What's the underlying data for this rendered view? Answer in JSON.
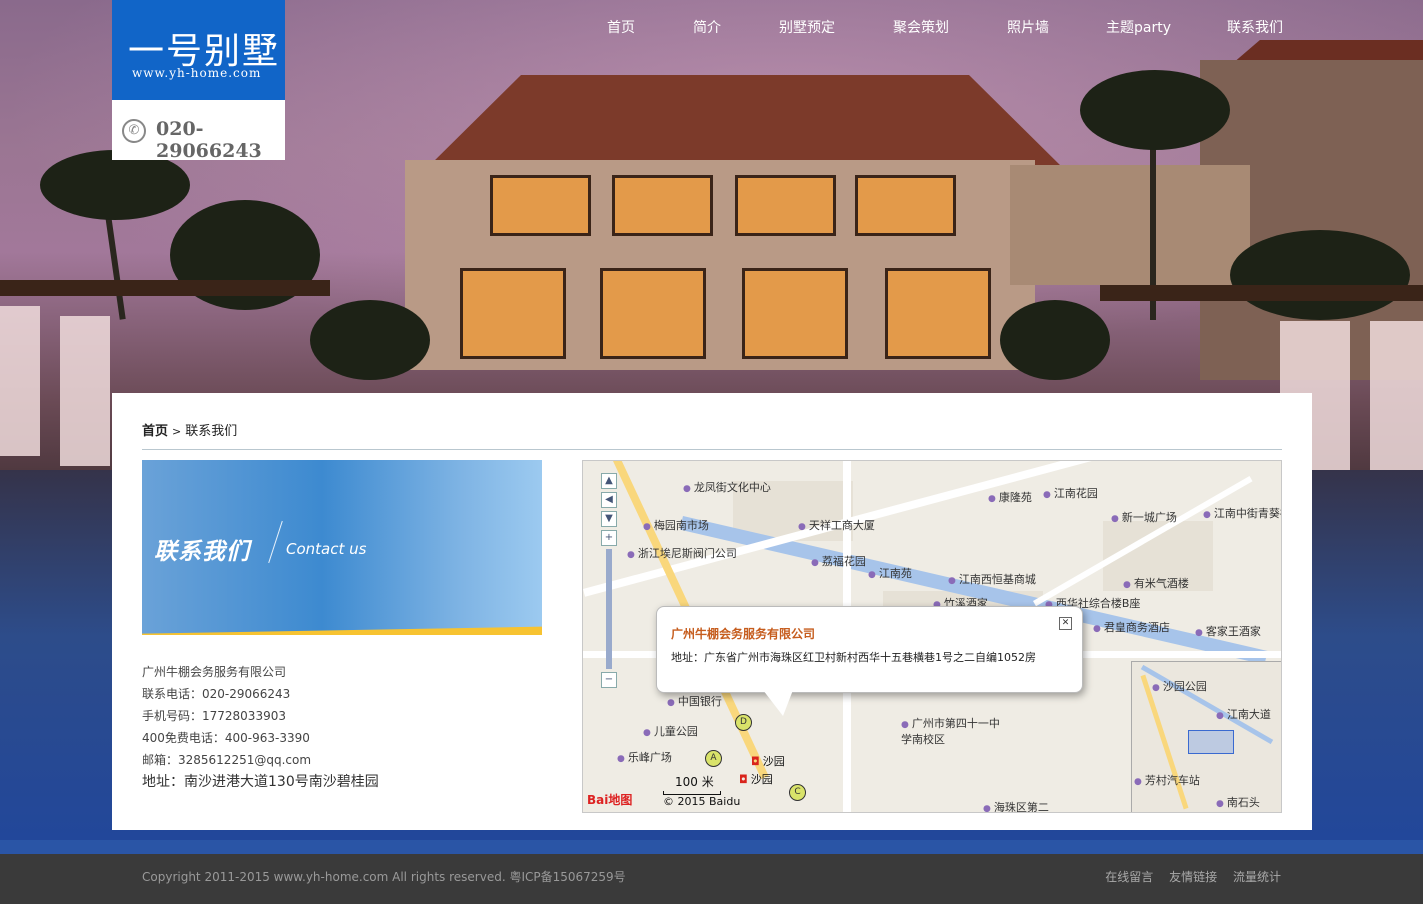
{
  "site": {
    "logo_title": "一号别墅",
    "logo_url": "www.yh-home.com",
    "phone": "020-29066243"
  },
  "nav": [
    "首页",
    "简介",
    "别墅预定",
    "聚会策划",
    "照片墙",
    "主题party",
    "联系我们"
  ],
  "breadcrumb": {
    "home": "首页",
    "sep": ">",
    "current": "联系我们"
  },
  "banner": {
    "title_cn": "联系我们",
    "title_en": "Contact us"
  },
  "contact": {
    "company": "广州牛棚会务服务有限公司",
    "tel": "联系电话：020-29066243",
    "mobile": "手机号码：17728033903",
    "free": "400免费电话：400-963-3390",
    "email": "邮箱：3285612251@qq.com",
    "address": "地址：南沙进港大道130号南沙碧桂园"
  },
  "map": {
    "info_title": "广州牛棚会务服务有限公司",
    "info_address": "地址：广东省广州市海珠区红卫村新村西华十五巷横巷1号之二自编1052房",
    "scale": "100 米",
    "copyright": "© 2015 Baidu",
    "logo": "Bai地图",
    "pois": [
      "龙凤街文化中心",
      "江南花园",
      "康隆苑",
      "江南中街青葵社区",
      "梅园南市场",
      "天祥工商大厦",
      "新一城广场",
      "浙江埃尼斯阀门公司",
      "荔福花园",
      "江南苑",
      "江南西恒基商城",
      "有米气酒楼",
      "竹溪酒家",
      "西华社综合楼B座",
      "君皇商务酒店",
      "客家王酒家",
      "中国银行",
      "儿童公园",
      "乐峰广场",
      "广州市第四十一中学南校区",
      "海珠区第二"
    ],
    "stations": [
      "沙园",
      "沙园"
    ],
    "overview_labels": [
      "沙园公园",
      "江南大道",
      "芳村汽车站",
      "南石头"
    ]
  },
  "footer": {
    "copyright": "Copyright 2011-2015 www.yh-home.com All rights reserved. 粤ICP备15067259号",
    "links": [
      "在线留言",
      "友情链接",
      "流量统计"
    ]
  }
}
